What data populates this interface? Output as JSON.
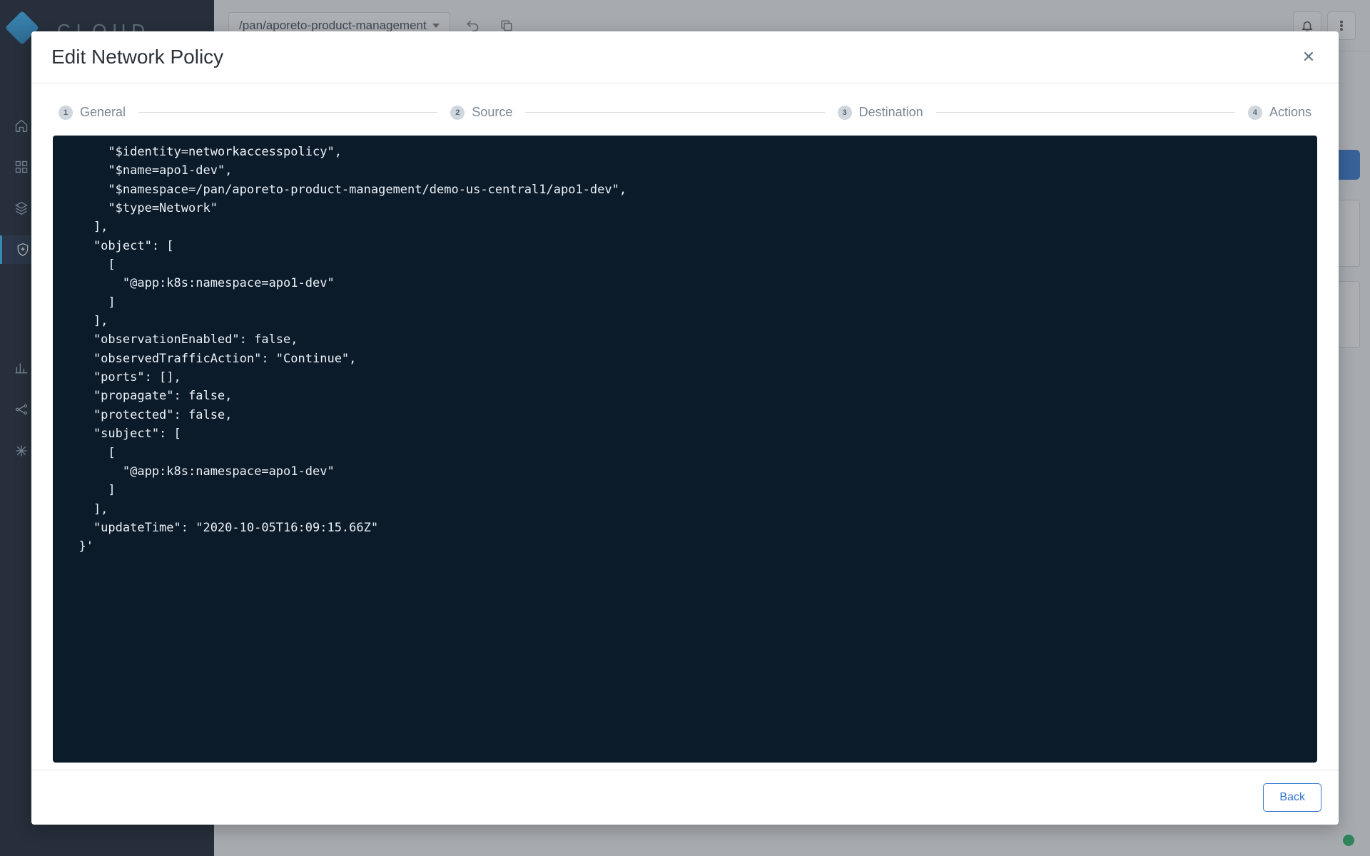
{
  "brand": "CLOUD",
  "namespace_picker": "/pan/aporeto-product-management",
  "modal": {
    "title": "Edit Network Policy",
    "back_label": "Back",
    "steps": [
      {
        "num": "1",
        "label": "General"
      },
      {
        "num": "2",
        "label": "Source"
      },
      {
        "num": "3",
        "label": "Destination"
      },
      {
        "num": "4",
        "label": "Actions"
      }
    ],
    "code": "      \"$identity=networkaccesspolicy\",\n      \"$name=apo1-dev\",\n      \"$namespace=/pan/aporeto-product-management/demo-us-central1/apo1-dev\",\n      \"$type=Network\"\n    ],\n    \"object\": [\n      [\n        \"@app:k8s:namespace=apo1-dev\"\n      ]\n    ],\n    \"observationEnabled\": false,\n    \"observedTrafficAction\": \"Continue\",\n    \"ports\": [],\n    \"propagate\": false,\n    \"protected\": false,\n    \"subject\": [\n      [\n        \"@app:k8s:namespace=apo1-dev\"\n      ]\n    ],\n    \"updateTime\": \"2020-10-05T16:09:15.66Z\"\n  }'"
  },
  "icons": {
    "home": "home-icon",
    "dashboard": "dashboard-icon",
    "layers": "layers-icon",
    "shield": "shield-icon",
    "chart": "chart-icon",
    "graph": "graph-icon",
    "star": "star-icon",
    "undo": "undo-icon",
    "copy": "copy-icon",
    "bell": "bell-icon",
    "kebab": "more-icon"
  }
}
